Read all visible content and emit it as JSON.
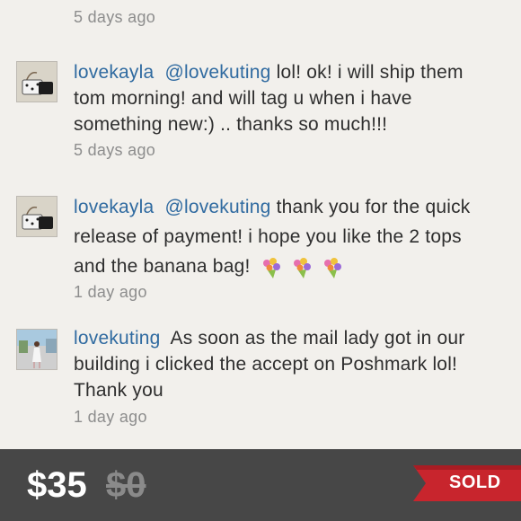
{
  "comments": [
    {
      "timestamp": "5 days ago"
    },
    {
      "user": "lovekayla",
      "mention": "@lovekuting",
      "text": "lol! ok! i will ship them tom morning! and will tag u when i have something new:) .. thanks so much!!!",
      "timestamp": "5 days ago"
    },
    {
      "user": "lovekayla",
      "mention": "@lovekuting",
      "text": "thank you for the quick release of payment! i hope you like the 2 tops and the banana bag!",
      "timestamp": "1 day ago"
    },
    {
      "user": "lovekuting",
      "text": "As soon as the mail lady got in our building i clicked the accept on Poshmark lol! Thank you",
      "timestamp": "1 day ago"
    }
  ],
  "listing": {
    "price": "$35",
    "original_price": "$0",
    "status": "SOLD"
  },
  "colors": {
    "background": "#f2f0ec",
    "username": "#2f6aa0",
    "bar": "#474747",
    "sold_ribbon": "#c8252d"
  }
}
